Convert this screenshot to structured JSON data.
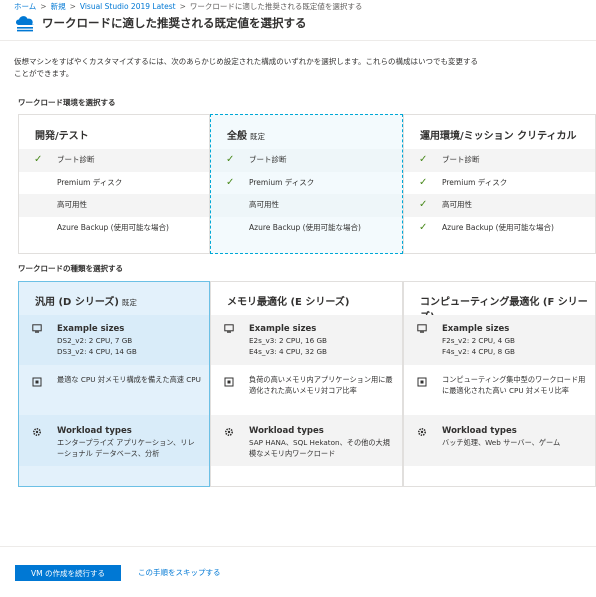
{
  "breadcrumb": [
    "ホーム",
    "新規",
    "Visual Studio 2019 Latest",
    "ワークロードに適した推奨される既定値を選択する"
  ],
  "header": {
    "title": "ワークロードに適した推奨される既定値を選択する"
  },
  "description": "仮想マシンをすばやくカスタマイズするには、次のあらかじめ設定された構成のいずれかを選択します。これらの構成はいつでも変更することができます。",
  "environment": {
    "label": "ワークロード環境を選択する",
    "columns": [
      {
        "title": "開発/テスト",
        "tag": "",
        "selected": false,
        "features": [
          {
            "label": "ブート診断",
            "checked": true
          },
          {
            "label": "Premium ディスク",
            "checked": false
          },
          {
            "label": "高可用性",
            "checked": false
          },
          {
            "label": "Azure Backup (使用可能な場合)",
            "checked": false
          }
        ]
      },
      {
        "title": "全般",
        "tag": "既定",
        "selected": true,
        "features": [
          {
            "label": "ブート診断",
            "checked": true
          },
          {
            "label": "Premium ディスク",
            "checked": true
          },
          {
            "label": "高可用性",
            "checked": false
          },
          {
            "label": "Azure Backup (使用可能な場合)",
            "checked": false
          }
        ]
      },
      {
        "title": "運用環境/ミッション クリティカル",
        "tag": "",
        "selected": false,
        "features": [
          {
            "label": "ブート診断",
            "checked": true
          },
          {
            "label": "Premium ディスク",
            "checked": true
          },
          {
            "label": "高可用性",
            "checked": true
          },
          {
            "label": "Azure Backup (使用可能な場合)",
            "checked": true
          }
        ]
      }
    ]
  },
  "workload": {
    "label": "ワークロードの種類を選択する",
    "columns": [
      {
        "title": "汎用 (D シリーズ)",
        "tag": "既定",
        "selected": true,
        "sizes_title": "Example sizes",
        "sizes": [
          "DS2_v2: 2 CPU, 7 GB",
          "DS3_v2: 4 CPU, 14 GB"
        ],
        "ratio": "最適な CPU 対メモリ構成を備えた高速 CPU",
        "types_title": "Workload types",
        "types": "エンタープライズ アプリケーション、リレーショナル データベース、分析"
      },
      {
        "title": "メモリ最適化 (E シリーズ)",
        "tag": "",
        "selected": false,
        "sizes_title": "Example sizes",
        "sizes": [
          "E2s_v3: 2 CPU, 16 GB",
          "E4s_v3: 4 CPU, 32 GB"
        ],
        "ratio": "負荷の高いメモリ内アプリケーション用に最適化された高いメモリ対コア比率",
        "types_title": "Workload types",
        "types": "SAP HANA、SQL Hekaton、その他の大規模なメモリ内ワークロード"
      },
      {
        "title": "コンピューティング最適化 (F シリーズ)",
        "tag": "",
        "selected": false,
        "sizes_title": "Example sizes",
        "sizes": [
          "F2s_v2: 2 CPU, 4 GB",
          "F4s_v2: 4 CPU, 8 GB"
        ],
        "ratio": "コンピューティング集中型のワークロード用に最適化された高い CPU 対メモリ比率",
        "types_title": "Workload types",
        "types": "バッチ処理、Web サーバー、ゲーム"
      }
    ]
  },
  "footer": {
    "primary_label": "VM の作成を続行する",
    "skip_label": "この手順をスキップする"
  },
  "colors": {
    "accent": "#0078d4",
    "check": "#4a8a1d",
    "selected_border": "#00a8d6",
    "selected_fill": "#e3f1fb"
  }
}
